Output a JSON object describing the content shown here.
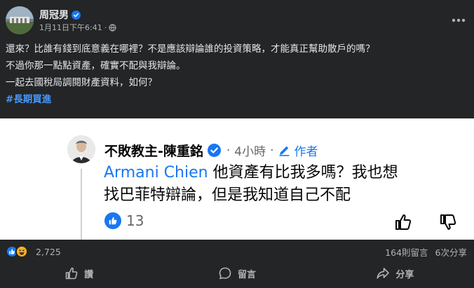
{
  "post": {
    "author": "周冠男",
    "timestamp": "1月11日下午6:41",
    "dot": "·",
    "verified_color": "#1877f2",
    "body_lines": [
      "還來？比誰有錢到底意義在哪裡？不是應該辯論誰的投資策略，才能真正幫助散戶的嗎？",
      "不過你那一點點資產，確實不配與我辯論。",
      "一起去國稅局調閱財產資料，如何？"
    ],
    "hashtag": "#長期買進",
    "icons": [
      "verified-icon",
      "globe-icon",
      "more-icon"
    ]
  },
  "embedded_comment": {
    "commenter": "不敗教主-陳重銘",
    "time": "4小時",
    "sep": "·",
    "author_badge": "作者",
    "mention": "Armani Chien",
    "text_line1": " 他資產有比我多嗎？我也想",
    "text_line2": "找巴菲特辯論，但是我知道自己不配",
    "like_count": "13",
    "accent": "#1877f2"
  },
  "reactions": {
    "count": "2,725",
    "comments": "164則留言",
    "shares": "6次分享",
    "types": [
      "like",
      "haha"
    ]
  },
  "actions": {
    "like": "讚",
    "comment": "留言",
    "share": "分享"
  }
}
